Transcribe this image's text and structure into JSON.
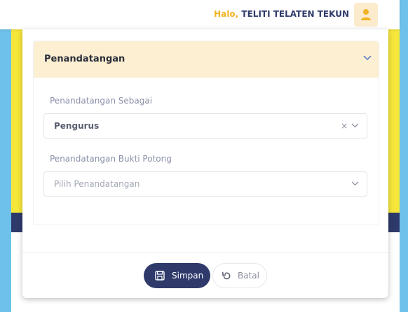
{
  "header": {
    "greeting_prefix": "Halo,",
    "user_name": "TELITI TELATEN TEKUN",
    "avatar_icon": "user-icon"
  },
  "section": {
    "title": "Penandatangan",
    "fields": [
      {
        "label": "Penandatangan Sebagai",
        "value": "Pengurus"
      },
      {
        "label": "Penandatangan Bukti Potong",
        "placeholder": "Pilih Penandatangan"
      }
    ]
  },
  "actions": {
    "save_label": "Simpan",
    "cancel_label": "Batal"
  },
  "colors": {
    "accent_navy": "#2f3a6b",
    "greeting_yellow": "#f0b323",
    "section_header_bg": "#fdefd2"
  }
}
